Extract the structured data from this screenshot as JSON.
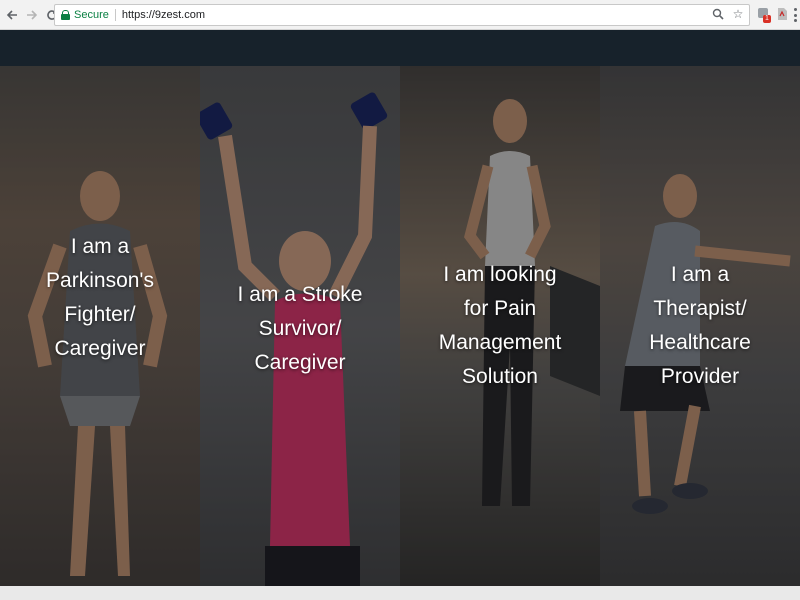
{
  "browser": {
    "secure_label": "Secure",
    "url": "https://9zest.com",
    "extension_badge": "1"
  },
  "panels": [
    {
      "lines": [
        "I am a",
        "Parkinson's",
        "Fighter/",
        "Caregiver"
      ]
    },
    {
      "lines": [
        "I am a Stroke",
        "Survivor/",
        "Caregiver"
      ]
    },
    {
      "lines": [
        "I am looking",
        "for Pain",
        "Management",
        "Solution"
      ]
    },
    {
      "lines": [
        "I am a",
        "Therapist/",
        "Healthcare",
        "Provider"
      ]
    }
  ],
  "colors": {
    "header_bg": "#17222b",
    "secure_green": "#0b8043",
    "shirt_pink": "#e23a73",
    "dumbbell_blue": "#1d2a6b"
  }
}
